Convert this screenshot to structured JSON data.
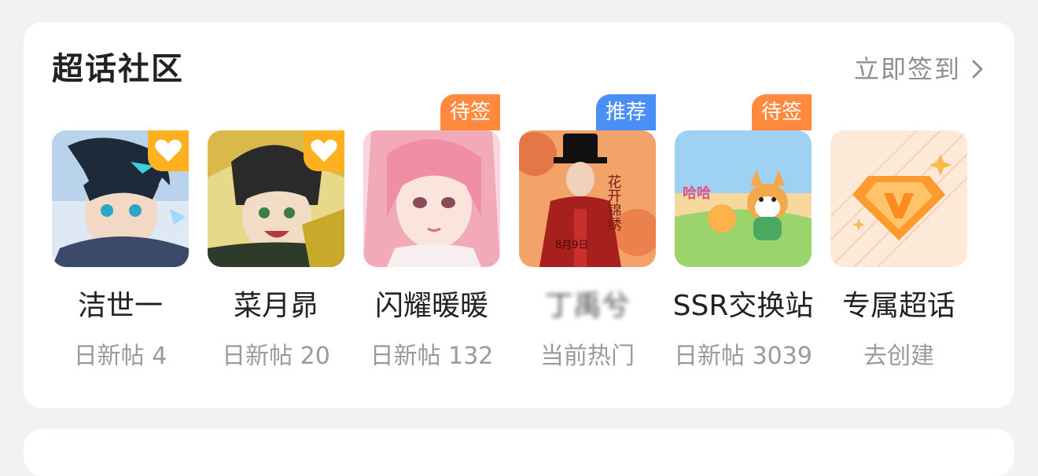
{
  "header": {
    "title": "超话社区",
    "action_label": "立即签到"
  },
  "topics": [
    {
      "name": "洁世一",
      "sub": "日新帖 4",
      "badge": "",
      "heart": true
    },
    {
      "name": "菜月昴",
      "sub": "日新帖 20",
      "badge": "",
      "heart": true
    },
    {
      "name": "闪耀暖暖",
      "sub": "日新帖 132",
      "badge": "待签",
      "heart": false
    },
    {
      "name": "丁禹兮",
      "sub": "当前热门",
      "badge": "推荐",
      "heart": false
    },
    {
      "name": "SSR交换站",
      "sub": "日新帖 3039",
      "badge": "待签",
      "heart": false
    },
    {
      "name": "专属超话",
      "sub": "去创建",
      "badge": "",
      "heart": false
    }
  ],
  "poster_text": {
    "title_vertical": "花开锦绣",
    "date": "8月9日"
  },
  "sticker_text": "哈哈",
  "colors": {
    "badge_orange": "#ff8a3d",
    "badge_blue": "#4a8ff5",
    "heart_badge": "#ffb020",
    "background": "#f2f2f4"
  }
}
